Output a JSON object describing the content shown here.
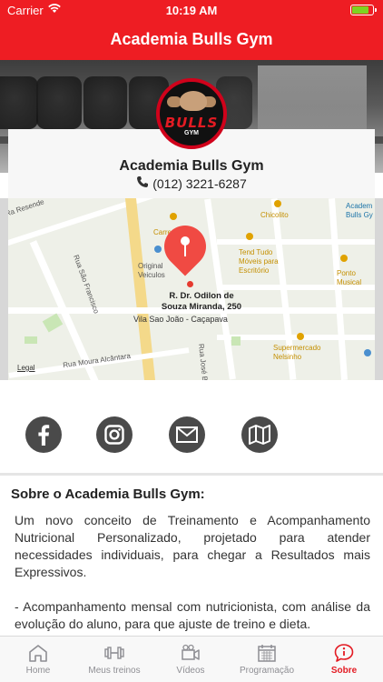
{
  "status_bar": {
    "carrier": "Carrier",
    "time": "10:19 AM",
    "battery_color": "#7ed321"
  },
  "nav": {
    "title": "Academia Bulls Gym",
    "bar_color": "#ee1d23"
  },
  "logo": {
    "word": "BULLS",
    "sub": "GYM"
  },
  "info": {
    "name": "Academia Bulls Gym",
    "phone": "(012) 3221-6287",
    "phone_icon": "phone-icon"
  },
  "map": {
    "address_line1": "R. Dr. Odilon de",
    "address_line2": "Souza Miranda, 250",
    "address_line3": "Vila Sao João - Caçapava",
    "legal": "Legal",
    "labels": {
      "resende": "Ra Resende",
      "carre": "Carre",
      "original": "Original",
      "veiculos": "Veiculos",
      "sao_francisco": "Rua São Francisco",
      "chicolito": "Chicolito",
      "academia1": "Academ",
      "academia2": "Bulls Gy",
      "tend1": "Tend Tudo",
      "tend2": "Móveis para",
      "tend3": "Escritório",
      "ponto1": "Ponto",
      "ponto2": "Musical",
      "super1": "Supermercado",
      "super2": "Nelsinho",
      "moura": "Rua Moura Alcântara",
      "jose": "Rua José B"
    }
  },
  "social": [
    {
      "name": "facebook-button",
      "icon": "facebook-icon"
    },
    {
      "name": "instagram-button",
      "icon": "instagram-icon"
    },
    {
      "name": "email-button",
      "icon": "mail-icon"
    },
    {
      "name": "map-button",
      "icon": "map-icon"
    }
  ],
  "about": {
    "title": "Sobre o Academia Bulls Gym:",
    "paragraph1": "Um novo conceito de Treinamento e Acompanhamento Nutricional Personalizado, projetado para atender necessidades individuais, para chegar a Resultados mais Expressivos.",
    "paragraph2": "- Acompanhamento mensal com nutricionista, com análise da evolução do aluno, para que ajuste de treino e dieta."
  },
  "tabs": [
    {
      "label": "Home",
      "icon": "home-icon",
      "active": false
    },
    {
      "label": "Meus treinos",
      "icon": "dumbbell-icon",
      "active": false
    },
    {
      "label": "Vídeos",
      "icon": "video-icon",
      "active": false
    },
    {
      "label": "Programação",
      "icon": "calendar-icon",
      "active": false
    },
    {
      "label": "Sobre",
      "icon": "info-icon",
      "active": true
    }
  ],
  "colors": {
    "accent": "#e31b23",
    "inactive_tab": "#8e8e93"
  }
}
